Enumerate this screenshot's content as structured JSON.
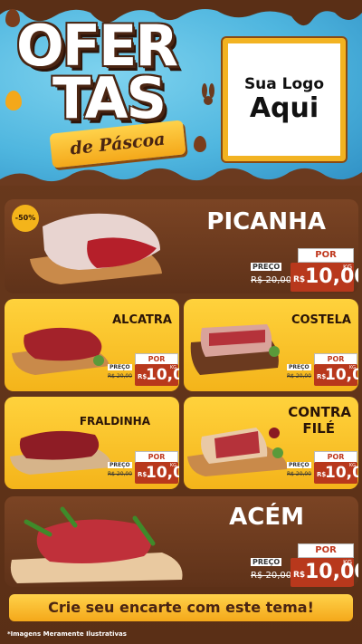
{
  "header": {
    "title_line1": "OFER",
    "title_line2": "TAS",
    "subtitle": "de Páscoa",
    "logo_line1": "Sua Logo",
    "logo_line2": "Aqui"
  },
  "products": [
    {
      "name": "PICANHA",
      "badge": "-50%",
      "por": "POR",
      "preco_label": "PREÇO",
      "old_price": "R$ 20,00",
      "currency": "R$",
      "price": "10,00",
      "unit": "KG"
    },
    {
      "name": "ALCATRA",
      "por": "POR",
      "preco_label": "PREÇO",
      "old_price": "R$ 20,00",
      "currency": "R$",
      "price": "10,00",
      "unit": "KG"
    },
    {
      "name": "COSTELA",
      "por": "POR",
      "preco_label": "PREÇO",
      "old_price": "R$ 20,00",
      "currency": "R$",
      "price": "10,00",
      "unit": "KG"
    },
    {
      "name": "FRALDINHA",
      "por": "POR",
      "preco_label": "PREÇO",
      "old_price": "R$ 20,00",
      "currency": "R$",
      "price": "10,00",
      "unit": "KG"
    },
    {
      "name_line1": "CONTRA",
      "name_line2": "FILÉ",
      "por": "POR",
      "preco_label": "PREÇO",
      "old_price": "R$ 20,00",
      "currency": "R$",
      "price": "10,00",
      "unit": "KG"
    },
    {
      "name": "ACÉM",
      "por": "POR",
      "preco_label": "PREÇO",
      "old_price": "R$ 20,00",
      "currency": "R$",
      "price": "10,00",
      "unit": "KG"
    }
  ],
  "footer": {
    "cta": "Crie seu encarte com este tema!",
    "disclaimer": "*Imagens Meramente Ilustrativas"
  },
  "colors": {
    "brown": "#6b3a1f",
    "yellow": "#f4b41a",
    "sky": "#4fb6df",
    "price_red": "#b8381c"
  }
}
